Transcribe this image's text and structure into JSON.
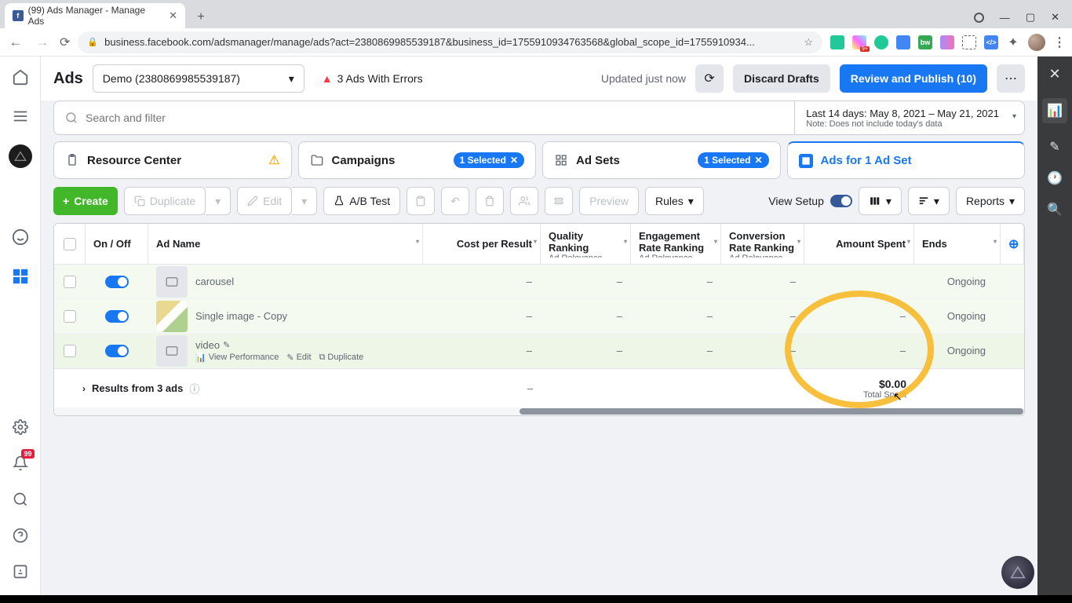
{
  "browser": {
    "tab_title": "(99) Ads Manager - Manage Ads",
    "url": "business.facebook.com/adsmanager/manage/ads?act=2380869985539187&business_id=1755910934763568&global_scope_id=1755910934..."
  },
  "header": {
    "title": "Ads",
    "account": "Demo (2380869985539187)",
    "errors": "3 Ads With Errors",
    "updated": "Updated just now",
    "discard": "Discard Drafts",
    "publish": "Review and Publish (10)"
  },
  "search": {
    "placeholder": "Search and filter"
  },
  "date": {
    "line1": "Last 14 days: May 8, 2021 – May 21, 2021",
    "line2": "Note: Does not include today's data"
  },
  "tabs": {
    "resource": "Resource Center",
    "campaigns": "Campaigns",
    "campaigns_sel": "1 Selected",
    "adsets": "Ad Sets",
    "adsets_sel": "1 Selected",
    "ads": "Ads for 1 Ad Set"
  },
  "toolbar": {
    "create": "Create",
    "duplicate": "Duplicate",
    "edit": "Edit",
    "abtest": "A/B Test",
    "preview": "Preview",
    "rules": "Rules",
    "viewsetup": "View Setup",
    "reports": "Reports"
  },
  "columns": {
    "onoff": "On / Off",
    "name": "Ad Name",
    "cpr": "Cost per Result",
    "qr": "Quality Ranking",
    "er": "Engagement Rate Ranking",
    "cr": "Conversion Rate Ranking",
    "rel": "Ad Relevance ...",
    "amt": "Amount Spent",
    "ends": "Ends"
  },
  "rows": [
    {
      "name": "carousel",
      "cpr": "–",
      "qr": "–",
      "er": "–",
      "cr": "–",
      "amt": "",
      "ends": "Ongoing"
    },
    {
      "name": "Single image - Copy",
      "cpr": "–",
      "qr": "–",
      "er": "–",
      "cr": "–",
      "amt": "–",
      "ends": "Ongoing"
    },
    {
      "name": "video",
      "cpr": "–",
      "qr": "–",
      "er": "–",
      "cr": "–",
      "amt": "–",
      "ends": "Ongoing"
    }
  ],
  "hover_actions": {
    "view_perf": "View Performance",
    "edit": "Edit",
    "duplicate": "Duplicate"
  },
  "footer": {
    "results": "Results from 3 ads",
    "total": "$0.00",
    "total_label": "Total Spent"
  },
  "badges": {
    "notif": "99"
  }
}
